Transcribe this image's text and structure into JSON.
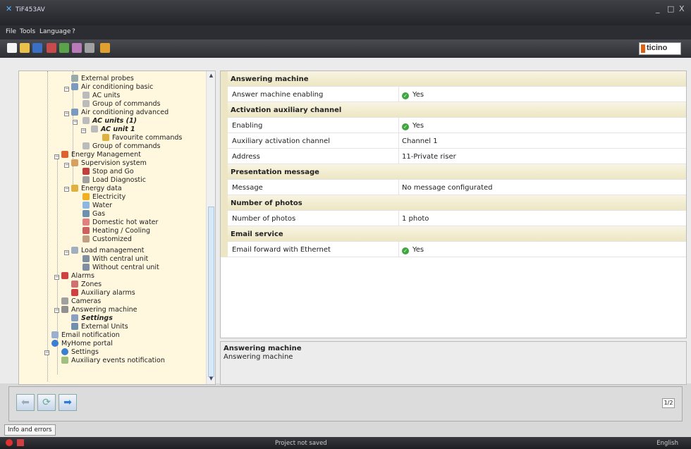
{
  "window": {
    "title": "TiF453AV",
    "controls": [
      "_",
      "□",
      "X"
    ]
  },
  "menu": [
    "File",
    "Tools",
    "Language",
    "?"
  ],
  "brand": {
    "text": "ticino",
    "accent": "#e06010"
  },
  "tree": {
    "items": [
      {
        "label": "External probes"
      },
      {
        "label": "Air conditioning basic"
      },
      {
        "label": "AC units"
      },
      {
        "label": "Group of commands"
      },
      {
        "label": "Air conditioning advanced"
      },
      {
        "label": "AC units (1)"
      },
      {
        "label": "AC unit 1"
      },
      {
        "label": "Favourite commands"
      },
      {
        "label": "Group of commands"
      },
      {
        "label": "Energy Management"
      },
      {
        "label": "Supervision system"
      },
      {
        "label": "Stop and Go"
      },
      {
        "label": "Load Diagnostic"
      },
      {
        "label": "Energy data"
      },
      {
        "label": "Electricity"
      },
      {
        "label": "Water"
      },
      {
        "label": "Gas"
      },
      {
        "label": "Domestic hot water"
      },
      {
        "label": "Heating / Cooling"
      },
      {
        "label": "Customized"
      },
      {
        "label": "Load management"
      },
      {
        "label": "With central unit"
      },
      {
        "label": "Without central unit"
      },
      {
        "label": "Alarms"
      },
      {
        "label": "Zones"
      },
      {
        "label": "Auxiliary alarms"
      },
      {
        "label": "Cameras"
      },
      {
        "label": "Answering machine"
      },
      {
        "label": "Settings"
      },
      {
        "label": "External Units"
      },
      {
        "label": "Email notification"
      },
      {
        "label": "MyHome portal"
      },
      {
        "label": "Settings"
      },
      {
        "label": "Auxiliary events notification"
      }
    ]
  },
  "props": {
    "rows": [
      {
        "type": "section",
        "label": "Answering machine"
      },
      {
        "type": "row",
        "label": "Answer machine enabling",
        "value": "Yes",
        "check": true
      },
      {
        "type": "section",
        "label": "Activation auxiliary channel"
      },
      {
        "type": "row",
        "label": "Enabling",
        "value": "Yes",
        "check": true
      },
      {
        "type": "row",
        "label": "Auxiliary activation channel",
        "value": "Channel 1"
      },
      {
        "type": "row",
        "label": "Address",
        "value": "11-Private riser"
      },
      {
        "type": "section",
        "label": "Presentation message"
      },
      {
        "type": "row",
        "label": "Message",
        "value": "No message configurated"
      },
      {
        "type": "section",
        "label": "Number of photos"
      },
      {
        "type": "row",
        "label": "Number of photos",
        "value": "1 photo"
      },
      {
        "type": "section",
        "label": "Email service"
      },
      {
        "type": "row",
        "label": "Email forward with Ethernet",
        "value": "Yes",
        "check": true
      }
    ]
  },
  "description": {
    "title": "Answering machine",
    "text": "Answering machine"
  },
  "nav": {
    "page": "1/2"
  },
  "info_tab": "Info and errors",
  "status": {
    "text": "Project not saved",
    "language": "English"
  }
}
